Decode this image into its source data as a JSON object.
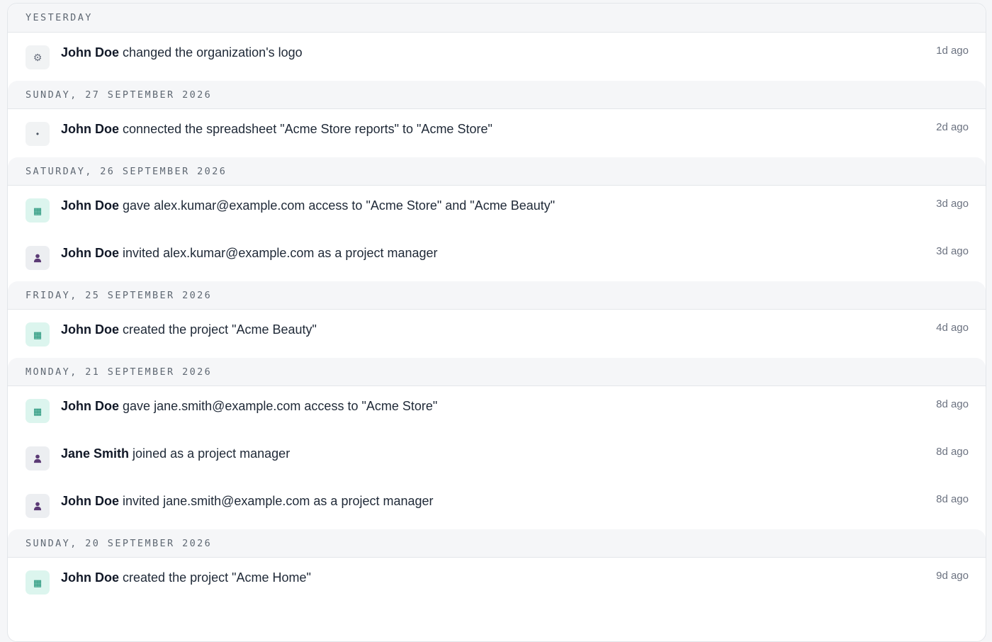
{
  "groups": [
    {
      "label": "YESTERDAY",
      "entries": [
        {
          "icon": "gear-icon",
          "glyph": "⚙",
          "actor": "John Doe",
          "action": "changed the organization's logo",
          "time": "1d ago"
        }
      ]
    },
    {
      "label": "SUNDAY, 27 SEPTEMBER 2026",
      "entries": [
        {
          "icon": "dot-icon",
          "glyph": "•",
          "actor": "John Doe",
          "action": "connected the spreadsheet \"Acme Store reports\" to \"Acme Store\"",
          "time": "2d ago"
        }
      ]
    },
    {
      "label": "SATURDAY, 26 SEPTEMBER 2026",
      "entries": [
        {
          "icon": "grid-icon",
          "glyph": "▦",
          "actor": "John Doe",
          "action": "gave alex.kumar@example.com access to \"Acme Store\" and \"Acme Beauty\"",
          "time": "3d ago"
        },
        {
          "icon": "user-icon",
          "glyph": "",
          "actor": "John Doe",
          "action": "invited alex.kumar@example.com as a project manager",
          "time": "3d ago"
        }
      ]
    },
    {
      "label": "FRIDAY, 25 SEPTEMBER 2026",
      "entries": [
        {
          "icon": "grid-icon",
          "glyph": "▦",
          "actor": "John Doe",
          "action": "created the project \"Acme Beauty\"",
          "time": "4d ago"
        }
      ]
    },
    {
      "label": "MONDAY, 21 SEPTEMBER 2026",
      "entries": [
        {
          "icon": "grid-icon",
          "glyph": "▦",
          "actor": "John Doe",
          "action": "gave jane.smith@example.com access to \"Acme Store\"",
          "time": "8d ago"
        },
        {
          "icon": "user-icon",
          "glyph": "",
          "actor": "Jane Smith",
          "action": "joined as a project manager",
          "time": "8d ago"
        },
        {
          "icon": "user-icon",
          "glyph": "",
          "actor": "John Doe",
          "action": "invited jane.smith@example.com as a project manager",
          "time": "8d ago"
        }
      ]
    },
    {
      "label": "SUNDAY, 20 SEPTEMBER 2026",
      "entries": [
        {
          "icon": "grid-icon",
          "glyph": "▦",
          "actor": "John Doe",
          "action": "created the project \"Acme Home\"",
          "time": "9d ago"
        }
      ]
    }
  ],
  "colors": {
    "grid_icon_bg": "#dcf5ee",
    "grid_icon_fg": "#0f8a6d",
    "user_icon_fg": "#5b3a75",
    "header_bg": "#f5f6f8"
  }
}
